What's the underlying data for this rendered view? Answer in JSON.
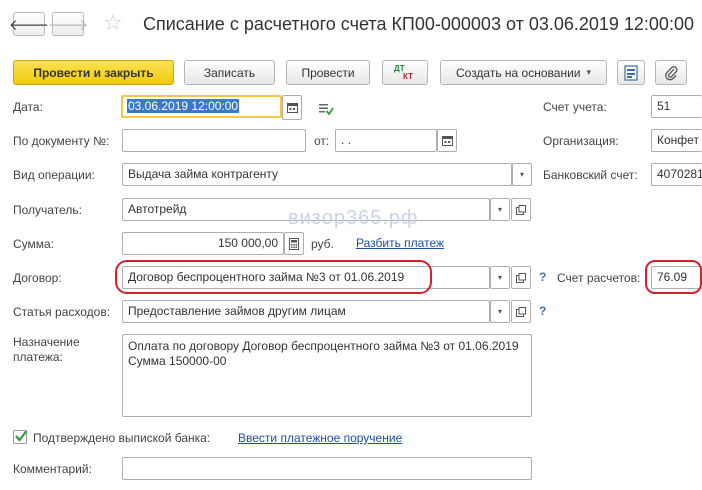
{
  "window": {
    "title": "Списание с расчетного счета КП00-000003 от 03.06.2019 12:00:00",
    "back_glyph": "🡐",
    "forward_glyph": "🡒",
    "star_glyph": "☆"
  },
  "toolbar": {
    "post_close": "Провести и закрыть",
    "save": "Записать",
    "post": "Провести",
    "dtkt_top": "ДТ",
    "dtkt_bottom": "КТ",
    "create_based": "Создать на основании",
    "caret": "▾"
  },
  "form": {
    "date": {
      "label": "Дата:",
      "value": "03.06.2019 12:00:00"
    },
    "doc_num": {
      "label": "По документу №:",
      "value": ""
    },
    "from": {
      "label": "от:",
      "value": " .  .    "
    },
    "op_type": {
      "label": "Вид операции:",
      "value": "Выдача займа контрагенту"
    },
    "recipient": {
      "label": "Получатель:",
      "value": "Автотрейд"
    },
    "amount": {
      "label": "Сумма:",
      "value": "150 000,00",
      "currency": "руб.",
      "split_link": "Разбить платеж"
    },
    "contract": {
      "label": "Договор:",
      "value": "Договор беспроцентного займа №3 от 01.06.2019",
      "help": "?"
    },
    "expense": {
      "label": "Статья расходов:",
      "value": "Предоставление займов другим лицам",
      "help": "?"
    },
    "purpose": {
      "label_line1": "Назначение",
      "label_line2": "платежа:",
      "line1": "Оплата по договору Договор беспроцентного займа №3 от 01.06.2019",
      "line2": "Сумма 150000-00"
    },
    "confirmed": {
      "label": "Подтверждено выпиской банка:",
      "link": "Ввести платежное поручение",
      "checked": true
    },
    "comment": {
      "label": "Комментарий:",
      "value": ""
    }
  },
  "right_panel": {
    "account": {
      "label": "Счет учета:",
      "value": "51"
    },
    "org": {
      "label": "Организация:",
      "value": "Конфет"
    },
    "bank_account": {
      "label": "Банковский счет:",
      "value": "4070281"
    },
    "settle_account": {
      "label": "Счет расчетов:",
      "value": "76.09"
    }
  },
  "watermark": "визор365.рф",
  "colors": {
    "primary": "#f5d12a",
    "highlight_ring": "#d4212a",
    "link": "#1b4fa8",
    "focus": "#f6c945"
  }
}
